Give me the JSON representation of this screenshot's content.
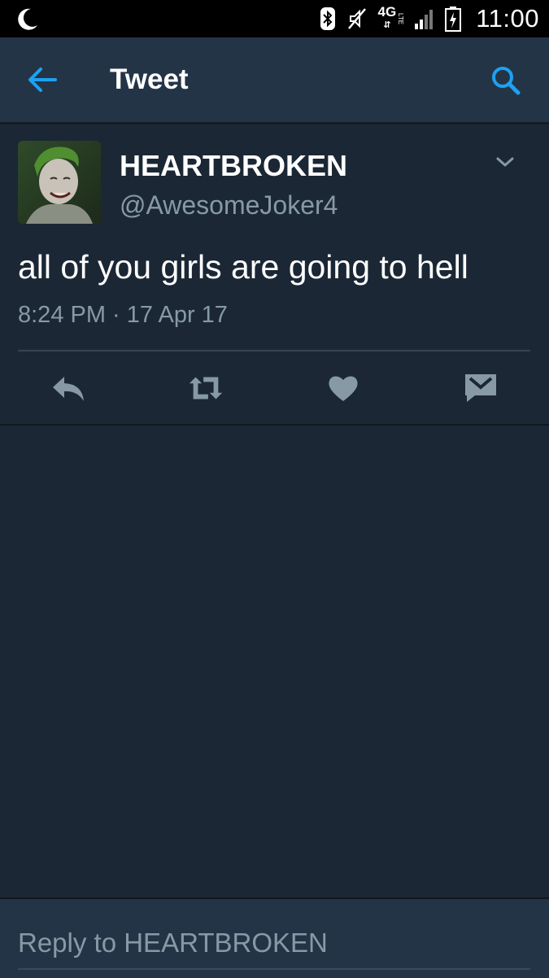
{
  "status_bar": {
    "time": "11:00",
    "network": "4G",
    "network_sub": "LTE",
    "icons": [
      "moon-icon",
      "bluetooth-icon",
      "mute-icon",
      "network-4g-icon",
      "signal-icon",
      "battery-icon"
    ]
  },
  "app_bar": {
    "title": "Tweet",
    "back_icon": "arrow-left-icon",
    "search_icon": "search-icon",
    "accent_color": "#1da1f2"
  },
  "tweet": {
    "display_name": "HEARTBROKEN",
    "handle": "@AwesomeJoker4",
    "text": "all of you girls are going to hell",
    "timestamp": "8:24 PM · 17 Apr 17",
    "actions": [
      "reply-icon",
      "retweet-icon",
      "heart-icon",
      "direct-message-icon"
    ]
  },
  "reply": {
    "placeholder": "Reply to HEARTBROKEN",
    "value": ""
  },
  "colors": {
    "background": "#1b2735",
    "bar": "#243447",
    "secondary_text": "#8899a6",
    "icon": "#8899a6"
  }
}
